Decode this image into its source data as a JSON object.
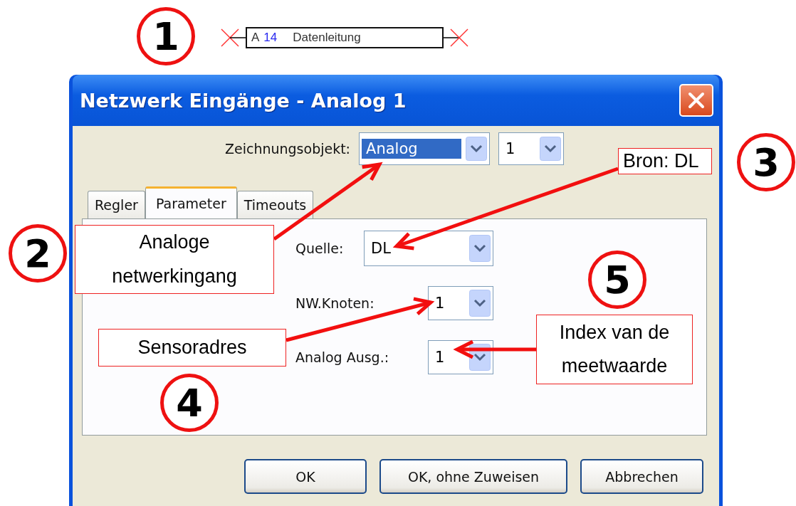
{
  "block": {
    "prefix": "A",
    "number": "14",
    "label": "Datenleitung"
  },
  "window": {
    "title": "Netzwerk Eingänge - Analog 1"
  },
  "drawing_object": {
    "label": "Zeichnungsobjekt:",
    "value": "Analog",
    "highlighted": true,
    "number": "1"
  },
  "tabs": [
    {
      "label": "Regler",
      "selected": false
    },
    {
      "label": "Parameter",
      "selected": true
    },
    {
      "label": "Timeouts",
      "selected": false
    }
  ],
  "fields": [
    {
      "label": "Quelle:",
      "value": "DL",
      "kind": "wide"
    },
    {
      "label": "NW.Knoten:",
      "value": "1",
      "kind": "narrow"
    },
    {
      "label": "Analog Ausg.:",
      "value": "1",
      "kind": "narrow"
    }
  ],
  "buttons": [
    "OK",
    "OK, ohne Zuweisen",
    "Abbrechen"
  ],
  "annotations": [
    {
      "number": "1"
    },
    {
      "number": "2",
      "text": "Analoge netwerkingang"
    },
    {
      "number": "3",
      "text": "Bron: DL"
    },
    {
      "number": "4",
      "text": "Sensoradres"
    },
    {
      "number": "5",
      "text": "Index van de meetwaarde"
    }
  ]
}
